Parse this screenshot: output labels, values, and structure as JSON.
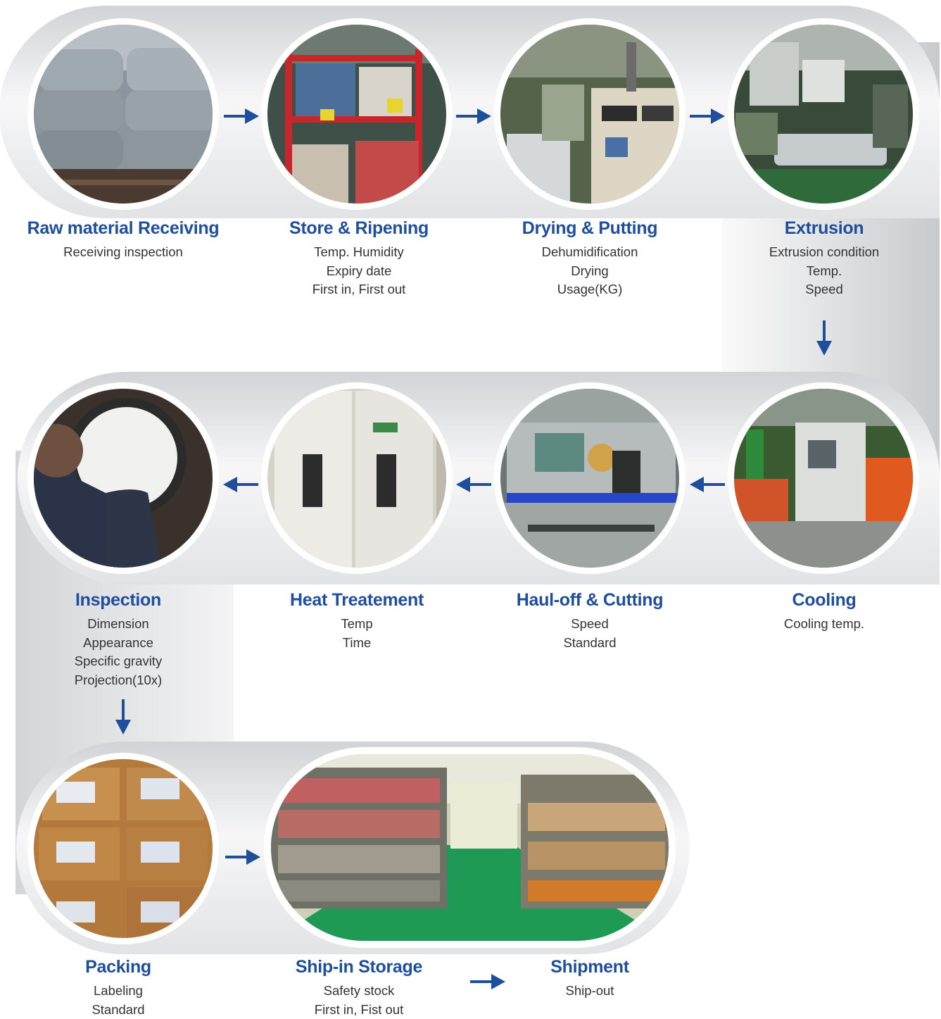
{
  "colors": {
    "title": "#1f4e9a",
    "arrow": "#1f4e9a",
    "text": "#333333",
    "track_light": "#f6f6f7",
    "track_dark": "#c6c7cb"
  },
  "steps": [
    {
      "id": "raw-material-receiving",
      "title": "Raw material Receiving",
      "details": [
        "Receiving inspection"
      ],
      "photo": "bagged-raw-material-photo"
    },
    {
      "id": "store-ripening",
      "title": "Store & Ripening",
      "details": [
        "Temp. Humidity",
        "Expiry date",
        "First in, First out"
      ],
      "photo": "storage-rack-photo"
    },
    {
      "id": "drying-putting",
      "title": "Drying & Putting",
      "details": [
        "Dehumidification",
        "Drying",
        "Usage(KG)"
      ],
      "photo": "dryer-machine-photo"
    },
    {
      "id": "extrusion",
      "title": "Extrusion",
      "details": [
        "Extrusion condition",
        "Temp.",
        "Speed"
      ],
      "photo": "extruder-photo"
    },
    {
      "id": "cooling",
      "title": "Cooling",
      "details": [
        "Cooling temp."
      ],
      "photo": "cooling-line-photo"
    },
    {
      "id": "haul-off-cutting",
      "title": "Haul-off & Cutting",
      "details": [
        "Speed",
        "Standard"
      ],
      "photo": "haul-off-cutter-photo"
    },
    {
      "id": "heat-treatement",
      "title": "Heat Treatement",
      "details": [
        "Temp",
        "Time"
      ],
      "photo": "heat-chamber-photo"
    },
    {
      "id": "inspection",
      "title": "Inspection",
      "details": [
        "Dimension",
        "Appearance",
        "Specific gravity",
        "Projection(10x)"
      ],
      "photo": "inspection-projector-photo"
    },
    {
      "id": "packing",
      "title": "Packing",
      "details": [
        "Labeling",
        "Standard"
      ],
      "photo": "packed-boxes-photo"
    },
    {
      "id": "ship-in-storage",
      "title": "Ship-in Storage",
      "details": [
        "Safety stock",
        "First in, Fist out"
      ],
      "photo": "warehouse-photo"
    },
    {
      "id": "shipment",
      "title": "Shipment",
      "details": [
        "Ship-out"
      ]
    }
  ]
}
